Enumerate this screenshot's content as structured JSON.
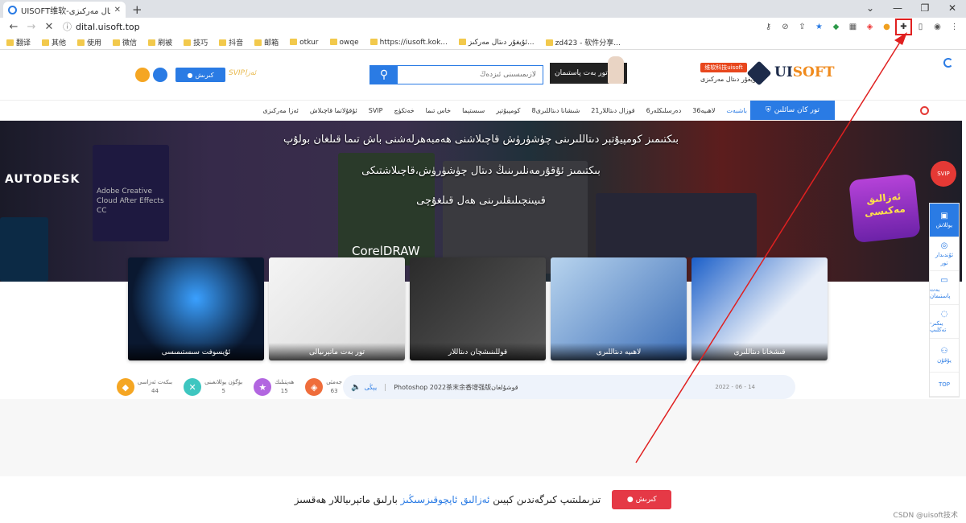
{
  "browser": {
    "tab_title": "UISOFT维软-ئۇيغۇر دىتال مەركىزى",
    "url": "dital.uisoft.top",
    "bookmarks": [
      "翻译",
      "其他",
      "使用",
      "微信",
      "刷被",
      "技巧",
      "抖音",
      "邮箱",
      "otkur",
      "owqe",
      "https://iusoft.kok...",
      "ئۇيغۇر دىتال مەركىز...",
      "zd423 - 软件分享..."
    ]
  },
  "header": {
    "logo_badge": "维软科技uisoft",
    "logo_sub": "ئۇيغۇر دىتال مەركىزى",
    "logo_word_a": "UI",
    "logo_word_b": "SOFT",
    "svip_ad": "تور بەت پاستىمان",
    "search_placeholder": "لازىمىسىنى ئىزدەڭ",
    "login_label": "كىرىش",
    "svip_label": "SVIPئەزا"
  },
  "nav": {
    "category_label": "تور كان سائلىن",
    "items": [
      "باشبەت",
      "لاھىيە36",
      "دەرسلىكلەر6",
      "قوزال دىتاللار21",
      "شىشانا دىتاللىرى8",
      "كومپيۇتېر",
      "سىستېما",
      "خاس تىما",
      "خەتكۈچ",
      "SVIP",
      "ئۇقۇلاتما قاچىلاش",
      "ئەزا مەركىزى"
    ]
  },
  "hero": {
    "line1": "بىكتىمىز كومپيۇتېر دىتاللىرىنى چۈشۈرۈش قاچىلاشنى ھەمبەھرلەشنى باش تىما قىلغان بولۇپ",
    "line2": "بىكتىمىز ئۇقۇرمەنلىرىنىڭ دىتال چۈشۈرۈش،قاچىلاشتىكى",
    "line3": "قىيىنچىلىقلىرىنى ھەل قىلغۇچى",
    "autodesk": "AUTODESK",
    "ae_caption": "Adobe Creative Cloud After Effects CC",
    "coreldraw": "CorelDRAW",
    "promo": "ئەزالىق مەكىسى"
  },
  "cards": [
    {
      "label": "ئۇيسوفت سىستىمىسى"
    },
    {
      "label": "تور بەت ماتېرىيالى"
    },
    {
      "label": "قوللىنىشچان دىتاللار"
    },
    {
      "label": "لاھىيە دىتاللىرى"
    },
    {
      "label": "قىشخانا دىتاللىرى"
    }
  ],
  "stats": [
    {
      "label": "بىكەت ئەزاسى",
      "value": "44",
      "color": "#f5a623"
    },
    {
      "label": "بۈگۈن يوللانغىنى",
      "value": "5",
      "color": "#3ec6c0"
    },
    {
      "label": "ھەپتىلىك",
      "value": "15",
      "color": "#b266e0"
    },
    {
      "label": "جەمئى",
      "value": "63",
      "color": "#ef6d3b"
    }
  ],
  "notice": {
    "label": "يېڭى",
    "text": "Photoshop 2022茶末余香增强版قوشۇلغان",
    "date": "2022 - 06 - 14"
  },
  "footer": {
    "text_a": "تىزىملىتىپ كىرگەندىن كېيىن ",
    "text_b": "ئەزالىق ئاپچوقىزسىڭىز",
    "text_c": " بارلىق ماتېرىياللار ھەقسىز",
    "button": "كىرىش",
    "watermark": "CSDN @uisoft技术"
  },
  "sidebar": {
    "svip": "SVIP",
    "items": [
      "يوللاش",
      "ئۇندىدار",
      "تور",
      "بەت پاستىمان",
      "يىكىر- تەكلىپ",
      "يۇقۇن",
      "TOP"
    ]
  },
  "colors": {
    "accent": "#2a7be4",
    "annotation": "#e02020"
  }
}
